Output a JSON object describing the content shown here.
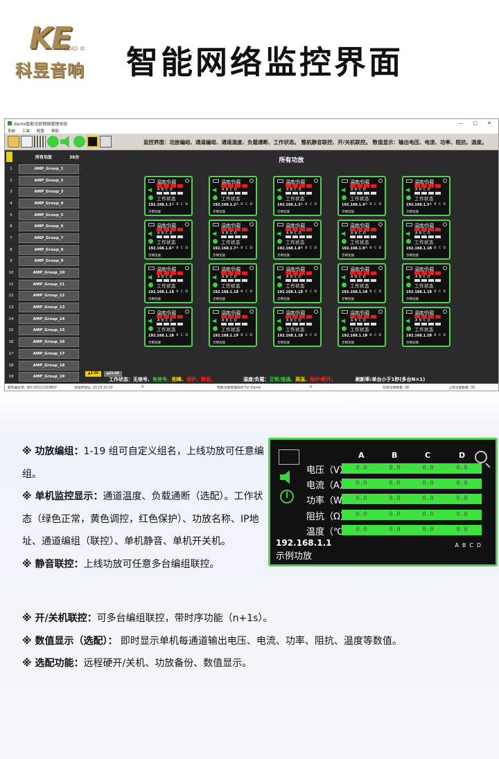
{
  "brand": {
    "mark": "KE",
    "sub": "AUDIO ®",
    "name": "科昱音响"
  },
  "page_title": "智能网络监控界面",
  "app": {
    "window_title": "dante智能功放网络管理系统",
    "menu": [
      "系统",
      "工具",
      "配置",
      "帮助"
    ],
    "window_controls": [
      "—",
      "□",
      "✕"
    ],
    "toolbar_text": "监控界面：功放编组、通道编组、通道温度、负载通断、工作状态。    整机静音联控、开/关机联控。    数值显示：输出电压、电流、功率、阻抗、温度。",
    "sidebar": {
      "header": {
        "title": "所有功放",
        "count": "38台"
      },
      "groups": [
        {
          "n": "1",
          "name": "AMP_Group_1"
        },
        {
          "n": "2",
          "name": "AMP_Group_2"
        },
        {
          "n": "3",
          "name": "AMP_Group_3"
        },
        {
          "n": "4",
          "name": "AMP_Group_4"
        },
        {
          "n": "5",
          "name": "AMP_Group_5"
        },
        {
          "n": "6",
          "name": "AMP_Group_6"
        },
        {
          "n": "7",
          "name": "AMP_Group_7"
        },
        {
          "n": "8",
          "name": "AMP_Group_8"
        },
        {
          "n": "9",
          "name": "AMP_Group_9"
        },
        {
          "n": "10",
          "name": "AMP_Group_10"
        },
        {
          "n": "11",
          "name": "AMP_Group_11"
        },
        {
          "n": "12",
          "name": "AMP_Group_12"
        },
        {
          "n": "13",
          "name": "AMP_Group_13"
        },
        {
          "n": "14",
          "name": "AMP_Group_14"
        },
        {
          "n": "15",
          "name": "AMP_Group_15"
        },
        {
          "n": "16",
          "name": "AMP_Group_16"
        },
        {
          "n": "17",
          "name": "AMP_Group_17"
        },
        {
          "n": "18",
          "name": "AMP_Group_18"
        },
        {
          "n": "19",
          "name": "AMP_Group_19"
        }
      ]
    },
    "content_title": "所有功放",
    "card_template": {
      "header": "温度/负载",
      "channels": "ABCD",
      "status": "工作状态",
      "ab": "A B C D",
      "name": "示例功放"
    },
    "cards": [
      {
        "ip": "192.168.1.1"
      },
      {
        "ip": "192.168.1.2"
      },
      {
        "ip": "192.168.1.3"
      },
      {
        "ip": "192.168.1.4"
      },
      {
        "ip": "192.168.1.5"
      },
      {
        "ip": "192.168.1.6"
      },
      {
        "ip": "192.168.1.7"
      },
      {
        "ip": "192.168.1.8"
      },
      {
        "ip": "192.168.1.9"
      },
      {
        "ip": "192.168.1.10"
      },
      {
        "ip": "192.168.1.11"
      },
      {
        "ip": "192.168.1.12"
      },
      {
        "ip": "192.168.1.13"
      },
      {
        "ip": "192.168.1.14"
      },
      {
        "ip": "192.168.1.15"
      },
      {
        "ip": "192.168.1.16"
      },
      {
        "ip": "192.168.1.17"
      },
      {
        "ip": "192.168.1.18"
      },
      {
        "ip": "192.168.1.19"
      },
      {
        "ip": "192.168.1.20"
      }
    ],
    "pages": [
      "▲1-20",
      "▲21-40"
    ],
    "legend": {
      "work_label": "工作状态：",
      "no_signal": "无信号、",
      "signal": "有信号、",
      "limit": "削峰、",
      "protect": "保护、",
      "mute": "静音。",
      "temp_label": "温度/负载：",
      "normal": "正常/接通、",
      "high_temp": "高温、",
      "protect2": "保护/断开。",
      "refresh": "刷新率:单台小于1秒(多台N×1)",
      "colors": {
        "white": "#ffffff",
        "green": "#3ecf3e",
        "yellow": "#f0e000",
        "red": "#ff2222"
      }
    },
    "statusbar": {
      "server": "服务器名称: SKY-20221103RCP",
      "local_ip": "本地IP地址: 10.10.10.50",
      "zero1": "0",
      "system": "智能功放管理系统 For Dante",
      "zero2": "0",
      "online": "在线功放数量: 38",
      "online2": "上线功放数量: 38"
    }
  },
  "descriptions": [
    {
      "key": "※ 功放编组：",
      "text": "1-19 组可自定义组名，上线功放可任意编组。"
    },
    {
      "key": "※ 单机监控显示：",
      "text": "通道温度、负载通断（选配）。工作状态（绿色正常，黄色调控，红色保护）、功放名称、IP地址、通道编组（联控）、单机静音、单机开关机。"
    },
    {
      "key": "※ 静音联控：",
      "text": "上线功放可任意多台编组联控。"
    }
  ],
  "descriptions2": [
    {
      "key": "※ 开/关机联控：",
      "text": "可多台编组联控，带时序功能（n+1s）。"
    },
    {
      "key": "※ 数值显示（选配）：",
      "text": " 即时显示单机每通道输出电压、电流、功率、阻抗、温度等数值。"
    },
    {
      "key": "※ 选配功能：",
      "text": "远程硬开/关机、功放备份、数值显示。"
    }
  ],
  "panel": {
    "channels": [
      "A",
      "B",
      "C",
      "D"
    ],
    "rows": [
      {
        "label": "电压（V）",
        "values": [
          "0.0",
          "0.0",
          "0.0",
          "0.0"
        ]
      },
      {
        "label": "电流（A）",
        "values": [
          "0.0",
          "0.0",
          "0.0",
          "0.0"
        ]
      },
      {
        "label": "功率（W）",
        "values": [
          "0.0",
          "0.0",
          "0.0",
          "0.0"
        ]
      },
      {
        "label": "阻抗（Ω）",
        "values": [
          "0.0",
          "0.0",
          "0.0",
          "0.0"
        ]
      },
      {
        "label": "温度（℃）",
        "values": [
          "0.0",
          "0.0",
          "0.0",
          "0.0"
        ]
      }
    ],
    "ip": "192.168.1.1",
    "name": "示例功放",
    "ab": "ABCD"
  }
}
